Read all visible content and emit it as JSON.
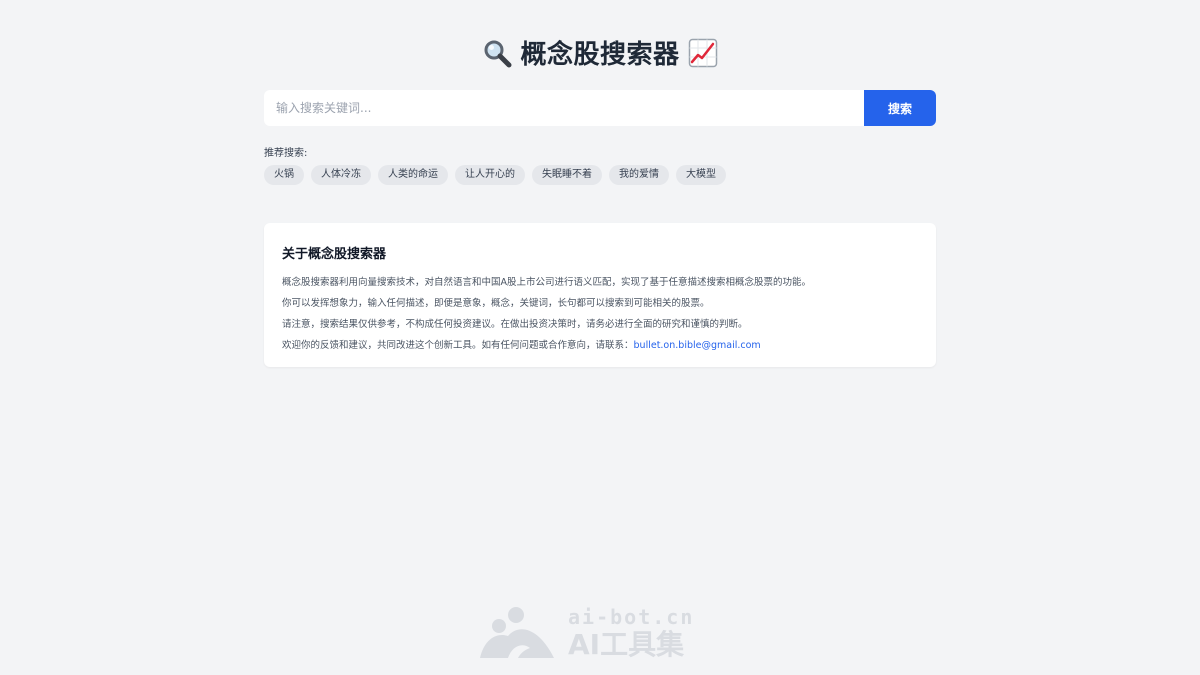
{
  "header": {
    "title": "概念股搜索器",
    "left_icon": "magnifier-emoji",
    "right_icon": "chart-increasing-emoji"
  },
  "search": {
    "placeholder": "输入搜索关键词...",
    "value": "",
    "button_label": "搜索"
  },
  "suggestions": {
    "label": "推荐搜索:",
    "items": [
      "火锅",
      "人体冷冻",
      "人类的命运",
      "让人开心的",
      "失眠睡不着",
      "我的爱情",
      "大模型"
    ]
  },
  "about": {
    "title": "关于概念股搜索器",
    "lines": [
      "概念股搜索器利用向量搜索技术，对自然语言和中国A股上市公司进行语义匹配，实现了基于任意描述搜索相概念股票的功能。",
      "你可以发挥想象力，输入任何描述，即便是意象，概念，关键词，长句都可以搜索到可能相关的股票。",
      "请注意，搜索结果仅供参考，不构成任何投资建议。在做出投资决策时，请务必进行全面的研究和谨慎的判断。",
      "欢迎你的反馈和建议，共同改进这个创新工具。如有任何问题或合作意向，请联系："
    ],
    "email": "bullet.on.bible@gmail.com"
  },
  "watermark": {
    "domain": "ai-bot.cn",
    "name": "AI工具集"
  },
  "colors": {
    "background": "#f3f4f6",
    "accent": "#2563eb",
    "chip": "#e5e7eb"
  }
}
